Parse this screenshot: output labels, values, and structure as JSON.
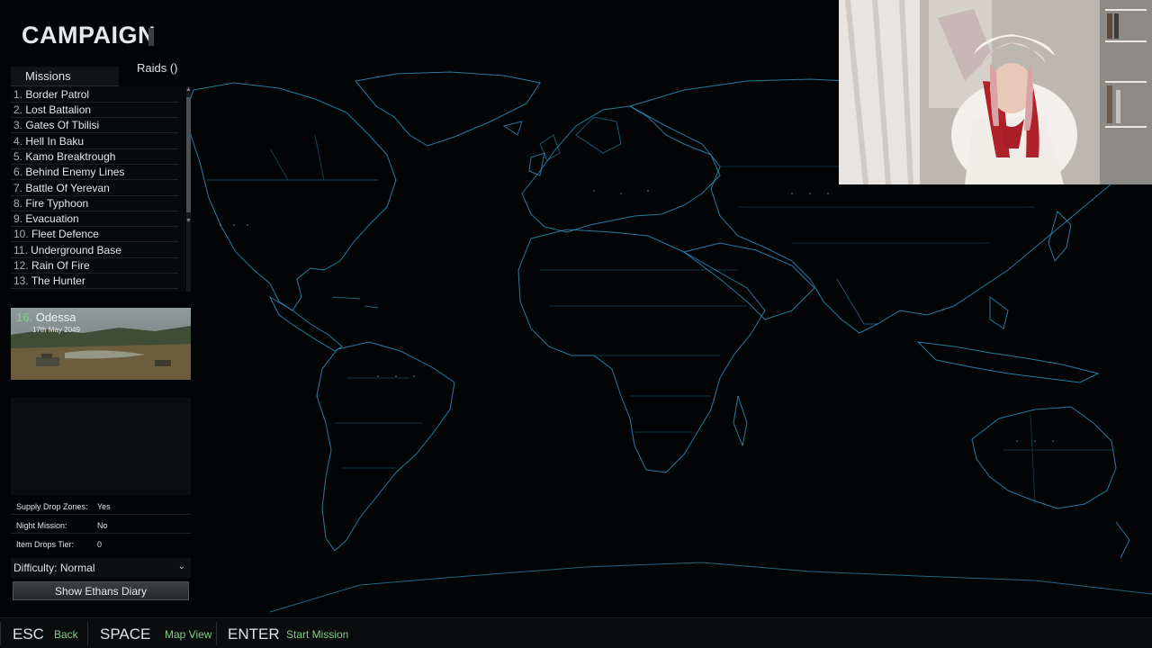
{
  "title": "CAMPAIGN",
  "tabs": {
    "missions": "Missions",
    "raids": "Raids ()"
  },
  "missions": [
    {
      "num": "1.",
      "name": "Border Patrol"
    },
    {
      "num": "2.",
      "name": "Lost Battalion"
    },
    {
      "num": "3.",
      "name": "Gates Of Tbilisi"
    },
    {
      "num": "4.",
      "name": "Hell In Baku"
    },
    {
      "num": "5.",
      "name": "Kamo Breaktrough"
    },
    {
      "num": "6.",
      "name": "Behind Enemy Lines"
    },
    {
      "num": "7.",
      "name": "Battle Of Yerevan"
    },
    {
      "num": "8.",
      "name": "Fire Typhoon"
    },
    {
      "num": "9.",
      "name": "Evacuation"
    },
    {
      "num": "10.",
      "name": "Fleet Defence"
    },
    {
      "num": "11.",
      "name": "Underground Base"
    },
    {
      "num": "12.",
      "name": "Rain Of Fire"
    },
    {
      "num": "13.",
      "name": "The Hunter"
    }
  ],
  "selected_mission": {
    "num": "16.",
    "name": "Odessa",
    "date": "17th May 2049"
  },
  "stats": [
    {
      "label": "Supply Drop Zones:",
      "value": "Yes"
    },
    {
      "label": "Night Mission:",
      "value": "No"
    },
    {
      "label": "Item Drops Tier:",
      "value": "0"
    }
  ],
  "difficulty": {
    "label": "Difficulty:",
    "value": "Normal"
  },
  "diary_button": "Show Ethans Diary",
  "bottom_bar": [
    {
      "key": "ESC",
      "label": "Back"
    },
    {
      "key": "SPACE",
      "label": "Map View"
    },
    {
      "key": "ENTER",
      "label": "Start Mission"
    }
  ],
  "colors": {
    "accent_green": "#7fd18b",
    "map_lines": "#2f8fb8",
    "background": "#020406"
  },
  "icons": [
    "chevron-down-icon",
    "scroll-up-icon",
    "scroll-down-icon"
  ]
}
